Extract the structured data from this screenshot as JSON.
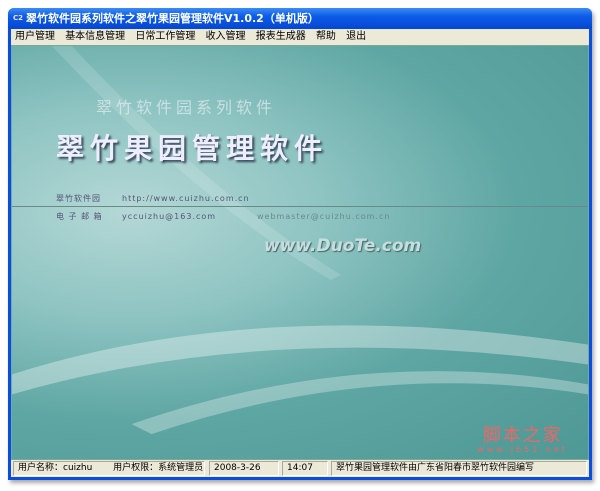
{
  "window": {
    "title": "翠竹软件园系列软件之翠竹果园管理软件V1.0.2（单机版）",
    "icon": "app-icon"
  },
  "menu": [
    "用户管理",
    "基本信息管理",
    "日常工作管理",
    "收入管理",
    "报表生成器",
    "帮助",
    "退出"
  ],
  "splash": {
    "subtitle": "翠竹软件园系列软件",
    "heading": "翠竹果园管理软件",
    "site_label": "翠竹软件园",
    "site_url": "http://www.cuizhu.com.cn",
    "email_label": "电 子 邮 箱",
    "email": "yccuizhu@163.com",
    "email2": "webmaster@cuizhu.com.cn",
    "watermark": "www.DuoTe.com",
    "jb_logo": "脚本之家",
    "jb_url": "www.jb51.net"
  },
  "status": {
    "user": "用户名称：cuizhu",
    "role": "用户权限：系统管理员",
    "date": "2008-3-26",
    "time": "14:07",
    "note": "翠竹果园管理软件由广东省阳春市翠竹软件园编写"
  }
}
